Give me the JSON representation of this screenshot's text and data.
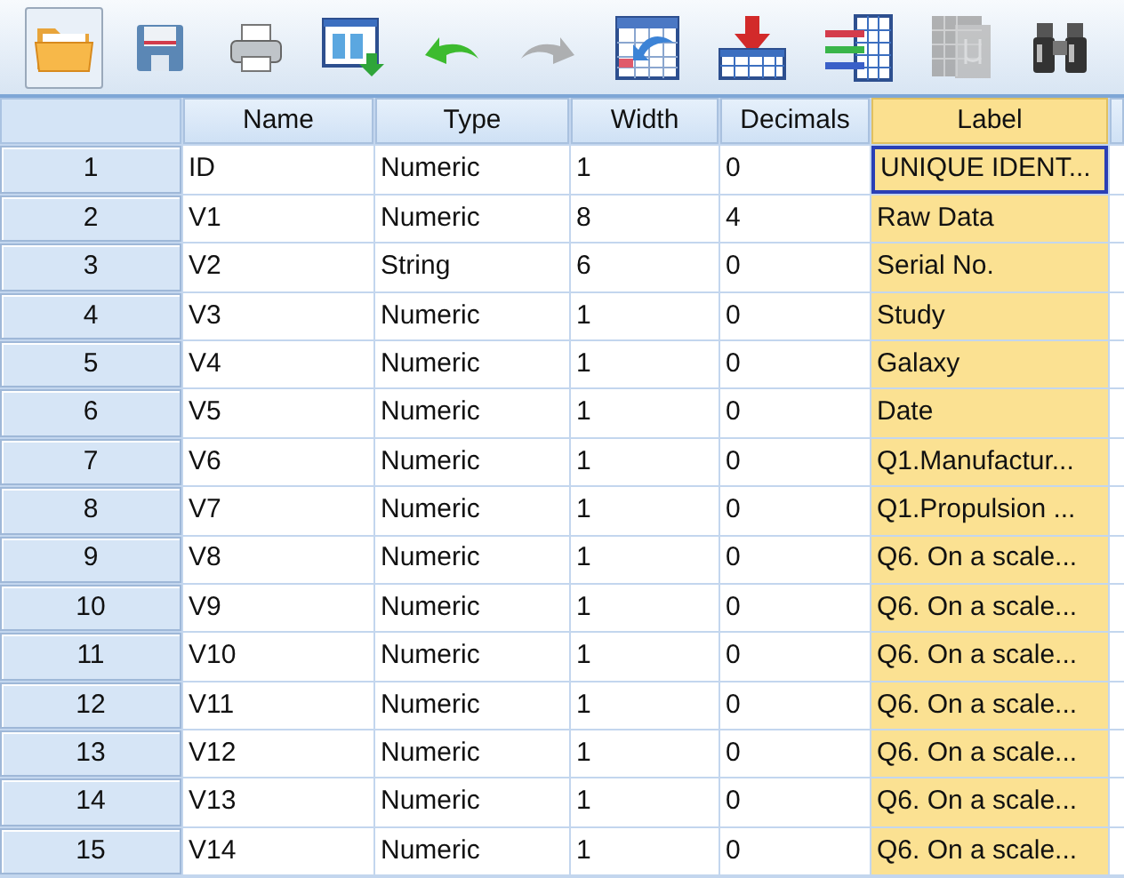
{
  "toolbar": [
    {
      "kind": "open",
      "disabled": false,
      "pressed": true
    },
    {
      "kind": "save",
      "disabled": false,
      "pressed": false
    },
    {
      "kind": "print",
      "disabled": false,
      "pressed": false
    },
    {
      "kind": "dialog",
      "disabled": false,
      "pressed": false
    },
    {
      "kind": "undo",
      "disabled": false,
      "pressed": false
    },
    {
      "kind": "redo",
      "disabled": true,
      "pressed": false
    },
    {
      "kind": "goto",
      "disabled": false,
      "pressed": false
    },
    {
      "kind": "insert",
      "disabled": false,
      "pressed": false
    },
    {
      "kind": "variables",
      "disabled": false,
      "pressed": false
    },
    {
      "kind": "value",
      "disabled": true,
      "pressed": false
    },
    {
      "kind": "find",
      "disabled": false,
      "pressed": false
    }
  ],
  "table": {
    "columns": [
      {
        "label": "Name",
        "selected": false
      },
      {
        "label": "Type",
        "selected": false
      },
      {
        "label": "Width",
        "selected": false
      },
      {
        "label": "Decimals",
        "selected": false
      },
      {
        "label": "Label",
        "selected": true
      }
    ],
    "rows": [
      {
        "number": "1",
        "cells": [
          "ID",
          "Numeric",
          "1",
          "0",
          "UNIQUE IDENT..."
        ],
        "focused": true
      },
      {
        "number": "2",
        "cells": [
          "V1",
          "Numeric",
          "8",
          "4",
          "Raw Data"
        ],
        "focused": false
      },
      {
        "number": "3",
        "cells": [
          "V2",
          "String",
          "6",
          "0",
          "Serial No."
        ],
        "focused": false
      },
      {
        "number": "4",
        "cells": [
          "V3",
          "Numeric",
          "1",
          "0",
          "Study"
        ],
        "focused": false
      },
      {
        "number": "5",
        "cells": [
          "V4",
          "Numeric",
          "1",
          "0",
          "Galaxy"
        ],
        "focused": false
      },
      {
        "number": "6",
        "cells": [
          "V5",
          "Numeric",
          "1",
          "0",
          "Date"
        ],
        "focused": false
      },
      {
        "number": "7",
        "cells": [
          "V6",
          "Numeric",
          "1",
          "0",
          "Q1.Manufactur..."
        ],
        "focused": false
      },
      {
        "number": "8",
        "cells": [
          "V7",
          "Numeric",
          "1",
          "0",
          "Q1.Propulsion ..."
        ],
        "focused": false
      },
      {
        "number": "9",
        "cells": [
          "V8",
          "Numeric",
          "1",
          "0",
          "Q6. On a scale..."
        ],
        "focused": false
      },
      {
        "number": "10",
        "cells": [
          "V9",
          "Numeric",
          "1",
          "0",
          "Q6. On a scale..."
        ],
        "focused": false
      },
      {
        "number": "11",
        "cells": [
          "V10",
          "Numeric",
          "1",
          "0",
          "Q6. On a scale..."
        ],
        "focused": false
      },
      {
        "number": "12",
        "cells": [
          "V11",
          "Numeric",
          "1",
          "0",
          "Q6. On a scale..."
        ],
        "focused": false
      },
      {
        "number": "13",
        "cells": [
          "V12",
          "Numeric",
          "1",
          "0",
          "Q6. On a scale..."
        ],
        "focused": false
      },
      {
        "number": "14",
        "cells": [
          "V13",
          "Numeric",
          "1",
          "0",
          "Q6. On a scale..."
        ],
        "focused": false
      },
      {
        "number": "15",
        "cells": [
          "V14",
          "Numeric",
          "1",
          "0",
          "Q6. On a scale..."
        ],
        "focused": false
      }
    ]
  }
}
